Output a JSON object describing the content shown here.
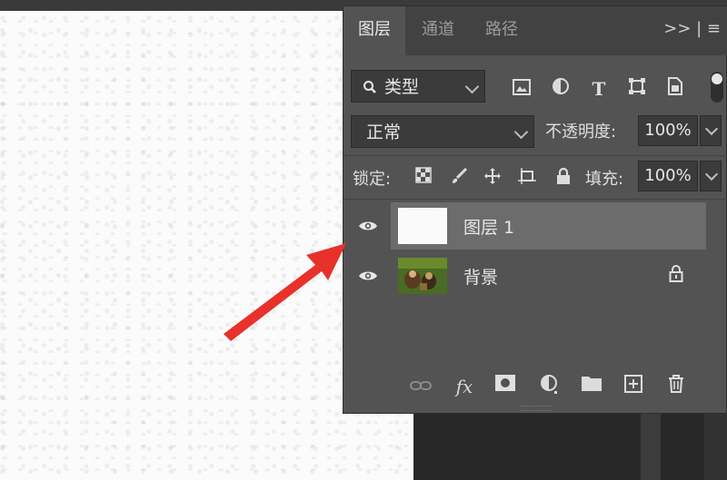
{
  "panel": {
    "tabs": [
      {
        "label": "图层",
        "active": true
      },
      {
        "label": "通道",
        "active": false
      },
      {
        "label": "路径",
        "active": false
      }
    ],
    "menu_label": ">> | ≡",
    "filter": {
      "label": "类型",
      "icon": "search-icon"
    },
    "filter_icons": [
      "image-filter-icon",
      "adjustment-filter-icon",
      "type-filter-icon",
      "shape-filter-icon",
      "smart-object-filter-icon"
    ],
    "blend_mode": "正常",
    "opacity_label": "不透明度:",
    "opacity_value": "100%",
    "lock_label": "锁定:",
    "lock_icons": [
      "lock-transparency-icon",
      "lock-image-icon",
      "lock-position-icon",
      "lock-artboard-icon",
      "lock-all-icon"
    ],
    "fill_label": "填充:",
    "fill_value": "100%",
    "layers": [
      {
        "name": "图层 1",
        "visible": true,
        "selected": true,
        "locked": false
      },
      {
        "name": "背景",
        "visible": true,
        "selected": false,
        "locked": true
      }
    ],
    "bottom_icons": [
      "link-icon",
      "fx-icon",
      "mask-icon",
      "adjustment-layer-icon",
      "group-folder-icon",
      "new-layer-icon",
      "trash-icon"
    ],
    "fx_label": "fx"
  },
  "colors": {
    "panel_bg": "#535353",
    "selected_layer": "#6c6c6c",
    "annotation_arrow": "#e8312b"
  }
}
